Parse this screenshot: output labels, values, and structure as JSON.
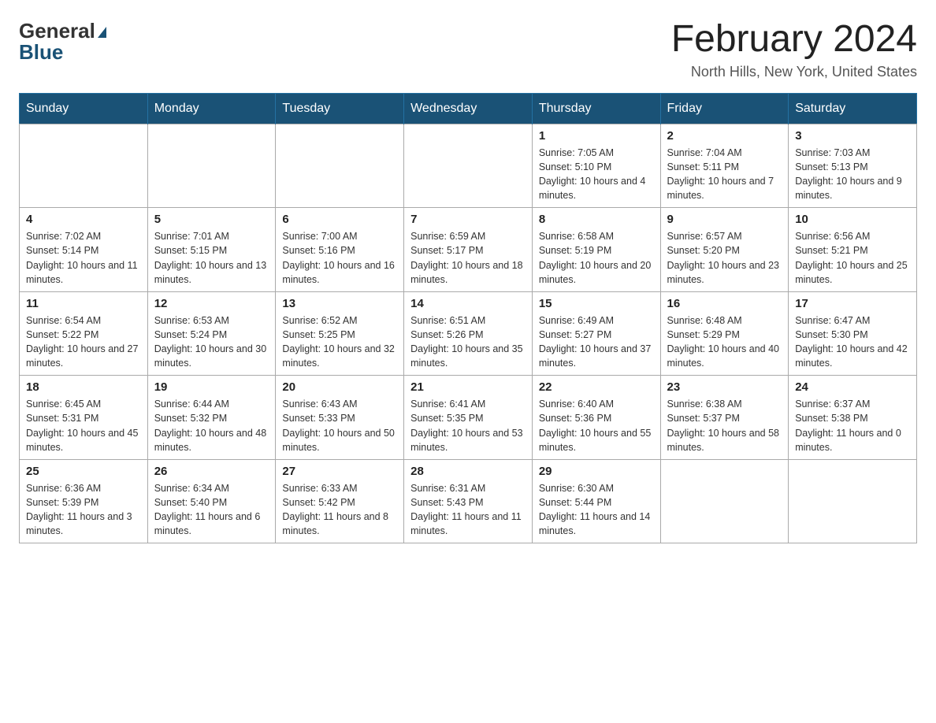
{
  "header": {
    "logo_general": "General",
    "logo_blue": "Blue",
    "month_title": "February 2024",
    "location": "North Hills, New York, United States"
  },
  "weekdays": [
    "Sunday",
    "Monday",
    "Tuesday",
    "Wednesday",
    "Thursday",
    "Friday",
    "Saturday"
  ],
  "weeks": [
    [
      {
        "day": "",
        "info": ""
      },
      {
        "day": "",
        "info": ""
      },
      {
        "day": "",
        "info": ""
      },
      {
        "day": "",
        "info": ""
      },
      {
        "day": "1",
        "info": "Sunrise: 7:05 AM\nSunset: 5:10 PM\nDaylight: 10 hours and 4 minutes."
      },
      {
        "day": "2",
        "info": "Sunrise: 7:04 AM\nSunset: 5:11 PM\nDaylight: 10 hours and 7 minutes."
      },
      {
        "day": "3",
        "info": "Sunrise: 7:03 AM\nSunset: 5:13 PM\nDaylight: 10 hours and 9 minutes."
      }
    ],
    [
      {
        "day": "4",
        "info": "Sunrise: 7:02 AM\nSunset: 5:14 PM\nDaylight: 10 hours and 11 minutes."
      },
      {
        "day": "5",
        "info": "Sunrise: 7:01 AM\nSunset: 5:15 PM\nDaylight: 10 hours and 13 minutes."
      },
      {
        "day": "6",
        "info": "Sunrise: 7:00 AM\nSunset: 5:16 PM\nDaylight: 10 hours and 16 minutes."
      },
      {
        "day": "7",
        "info": "Sunrise: 6:59 AM\nSunset: 5:17 PM\nDaylight: 10 hours and 18 minutes."
      },
      {
        "day": "8",
        "info": "Sunrise: 6:58 AM\nSunset: 5:19 PM\nDaylight: 10 hours and 20 minutes."
      },
      {
        "day": "9",
        "info": "Sunrise: 6:57 AM\nSunset: 5:20 PM\nDaylight: 10 hours and 23 minutes."
      },
      {
        "day": "10",
        "info": "Sunrise: 6:56 AM\nSunset: 5:21 PM\nDaylight: 10 hours and 25 minutes."
      }
    ],
    [
      {
        "day": "11",
        "info": "Sunrise: 6:54 AM\nSunset: 5:22 PM\nDaylight: 10 hours and 27 minutes."
      },
      {
        "day": "12",
        "info": "Sunrise: 6:53 AM\nSunset: 5:24 PM\nDaylight: 10 hours and 30 minutes."
      },
      {
        "day": "13",
        "info": "Sunrise: 6:52 AM\nSunset: 5:25 PM\nDaylight: 10 hours and 32 minutes."
      },
      {
        "day": "14",
        "info": "Sunrise: 6:51 AM\nSunset: 5:26 PM\nDaylight: 10 hours and 35 minutes."
      },
      {
        "day": "15",
        "info": "Sunrise: 6:49 AM\nSunset: 5:27 PM\nDaylight: 10 hours and 37 minutes."
      },
      {
        "day": "16",
        "info": "Sunrise: 6:48 AM\nSunset: 5:29 PM\nDaylight: 10 hours and 40 minutes."
      },
      {
        "day": "17",
        "info": "Sunrise: 6:47 AM\nSunset: 5:30 PM\nDaylight: 10 hours and 42 minutes."
      }
    ],
    [
      {
        "day": "18",
        "info": "Sunrise: 6:45 AM\nSunset: 5:31 PM\nDaylight: 10 hours and 45 minutes."
      },
      {
        "day": "19",
        "info": "Sunrise: 6:44 AM\nSunset: 5:32 PM\nDaylight: 10 hours and 48 minutes."
      },
      {
        "day": "20",
        "info": "Sunrise: 6:43 AM\nSunset: 5:33 PM\nDaylight: 10 hours and 50 minutes."
      },
      {
        "day": "21",
        "info": "Sunrise: 6:41 AM\nSunset: 5:35 PM\nDaylight: 10 hours and 53 minutes."
      },
      {
        "day": "22",
        "info": "Sunrise: 6:40 AM\nSunset: 5:36 PM\nDaylight: 10 hours and 55 minutes."
      },
      {
        "day": "23",
        "info": "Sunrise: 6:38 AM\nSunset: 5:37 PM\nDaylight: 10 hours and 58 minutes."
      },
      {
        "day": "24",
        "info": "Sunrise: 6:37 AM\nSunset: 5:38 PM\nDaylight: 11 hours and 0 minutes."
      }
    ],
    [
      {
        "day": "25",
        "info": "Sunrise: 6:36 AM\nSunset: 5:39 PM\nDaylight: 11 hours and 3 minutes."
      },
      {
        "day": "26",
        "info": "Sunrise: 6:34 AM\nSunset: 5:40 PM\nDaylight: 11 hours and 6 minutes."
      },
      {
        "day": "27",
        "info": "Sunrise: 6:33 AM\nSunset: 5:42 PM\nDaylight: 11 hours and 8 minutes."
      },
      {
        "day": "28",
        "info": "Sunrise: 6:31 AM\nSunset: 5:43 PM\nDaylight: 11 hours and 11 minutes."
      },
      {
        "day": "29",
        "info": "Sunrise: 6:30 AM\nSunset: 5:44 PM\nDaylight: 11 hours and 14 minutes."
      },
      {
        "day": "",
        "info": ""
      },
      {
        "day": "",
        "info": ""
      }
    ]
  ]
}
